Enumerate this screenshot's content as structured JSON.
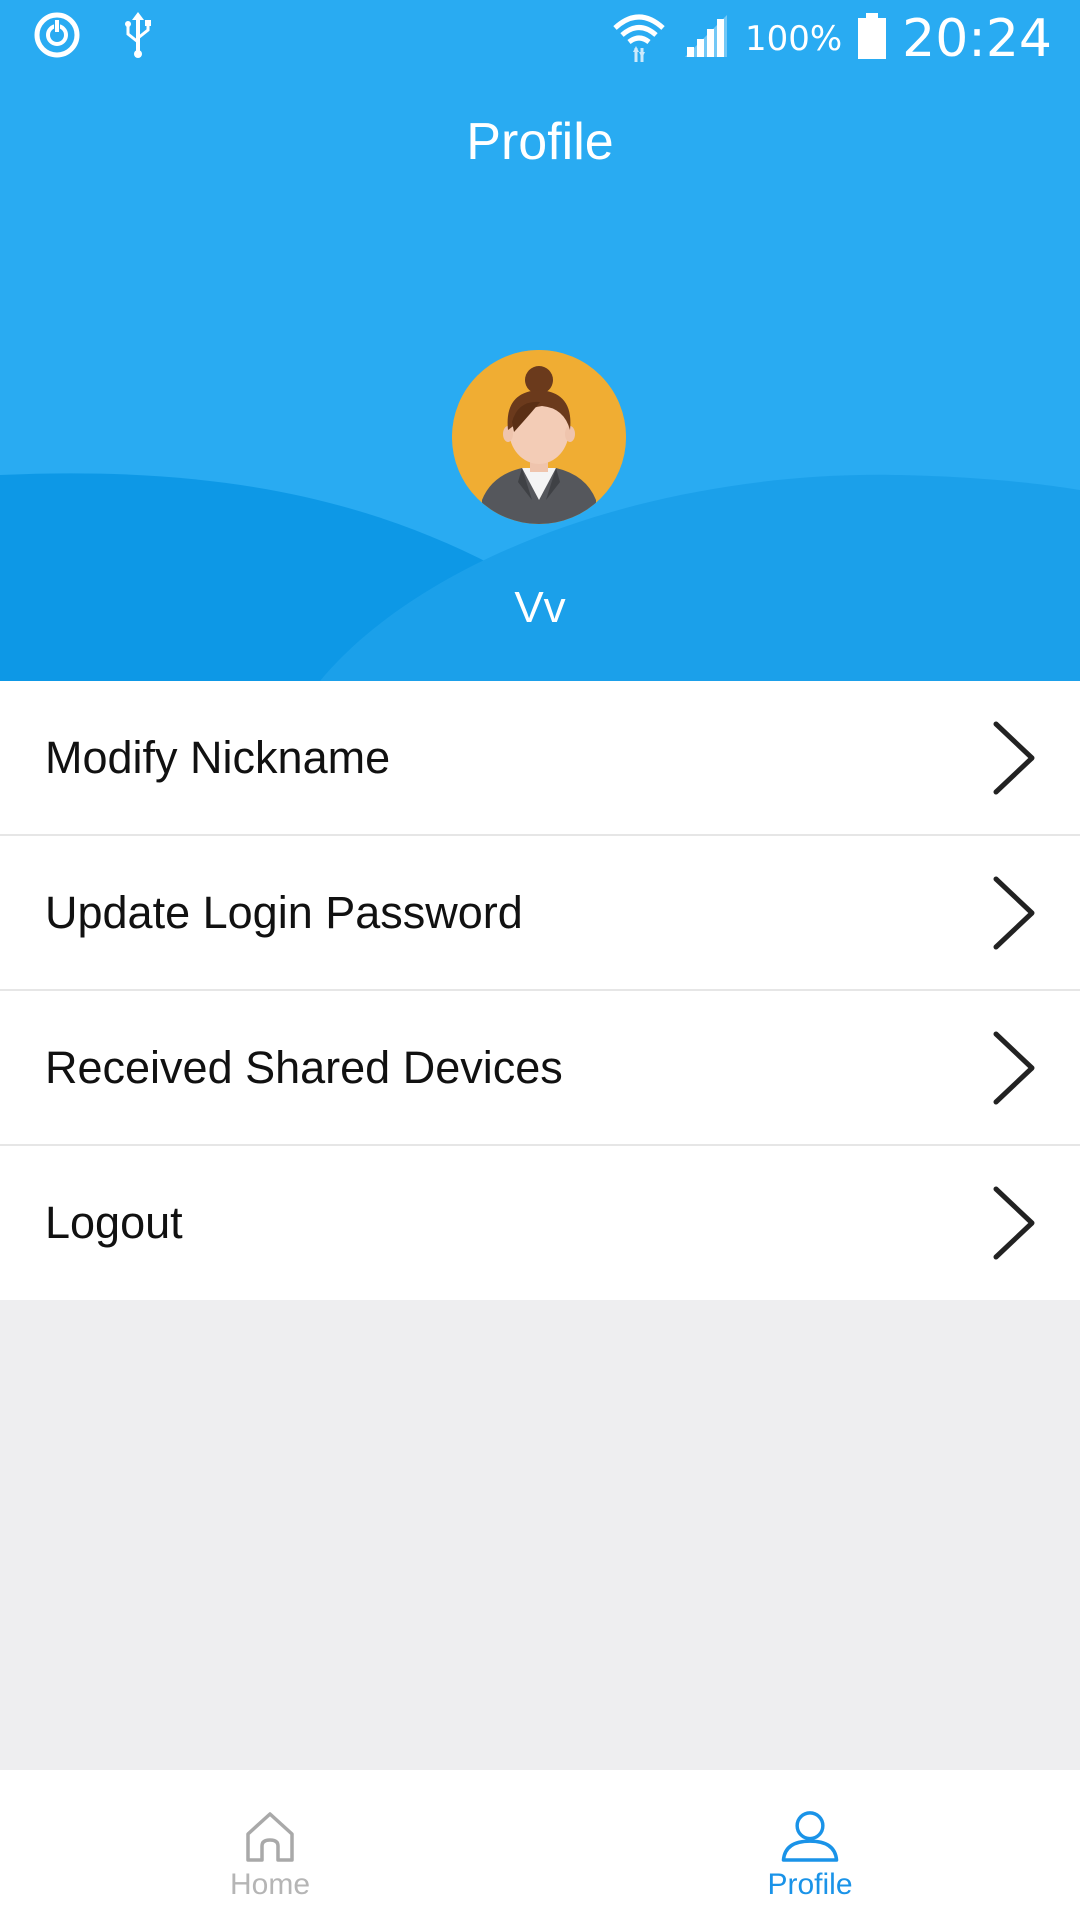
{
  "status_bar": {
    "battery_percent": "100%",
    "time": "20:24",
    "icons": [
      "sync-icon",
      "usb-icon",
      "wifi-icon",
      "signal-icon",
      "battery-icon"
    ]
  },
  "header": {
    "title": "Profile",
    "username": "Vv",
    "background_color": "#29abf2"
  },
  "menu": {
    "items": [
      {
        "label": "Modify Nickname"
      },
      {
        "label": "Update Login Password"
      },
      {
        "label": "Received Shared Devices"
      },
      {
        "label": "Logout"
      }
    ]
  },
  "tabbar": {
    "home_label": "Home",
    "profile_label": "Profile",
    "active_tab": "Profile",
    "active_color": "#1a93e8",
    "inactive_color": "#b5b5b5"
  }
}
